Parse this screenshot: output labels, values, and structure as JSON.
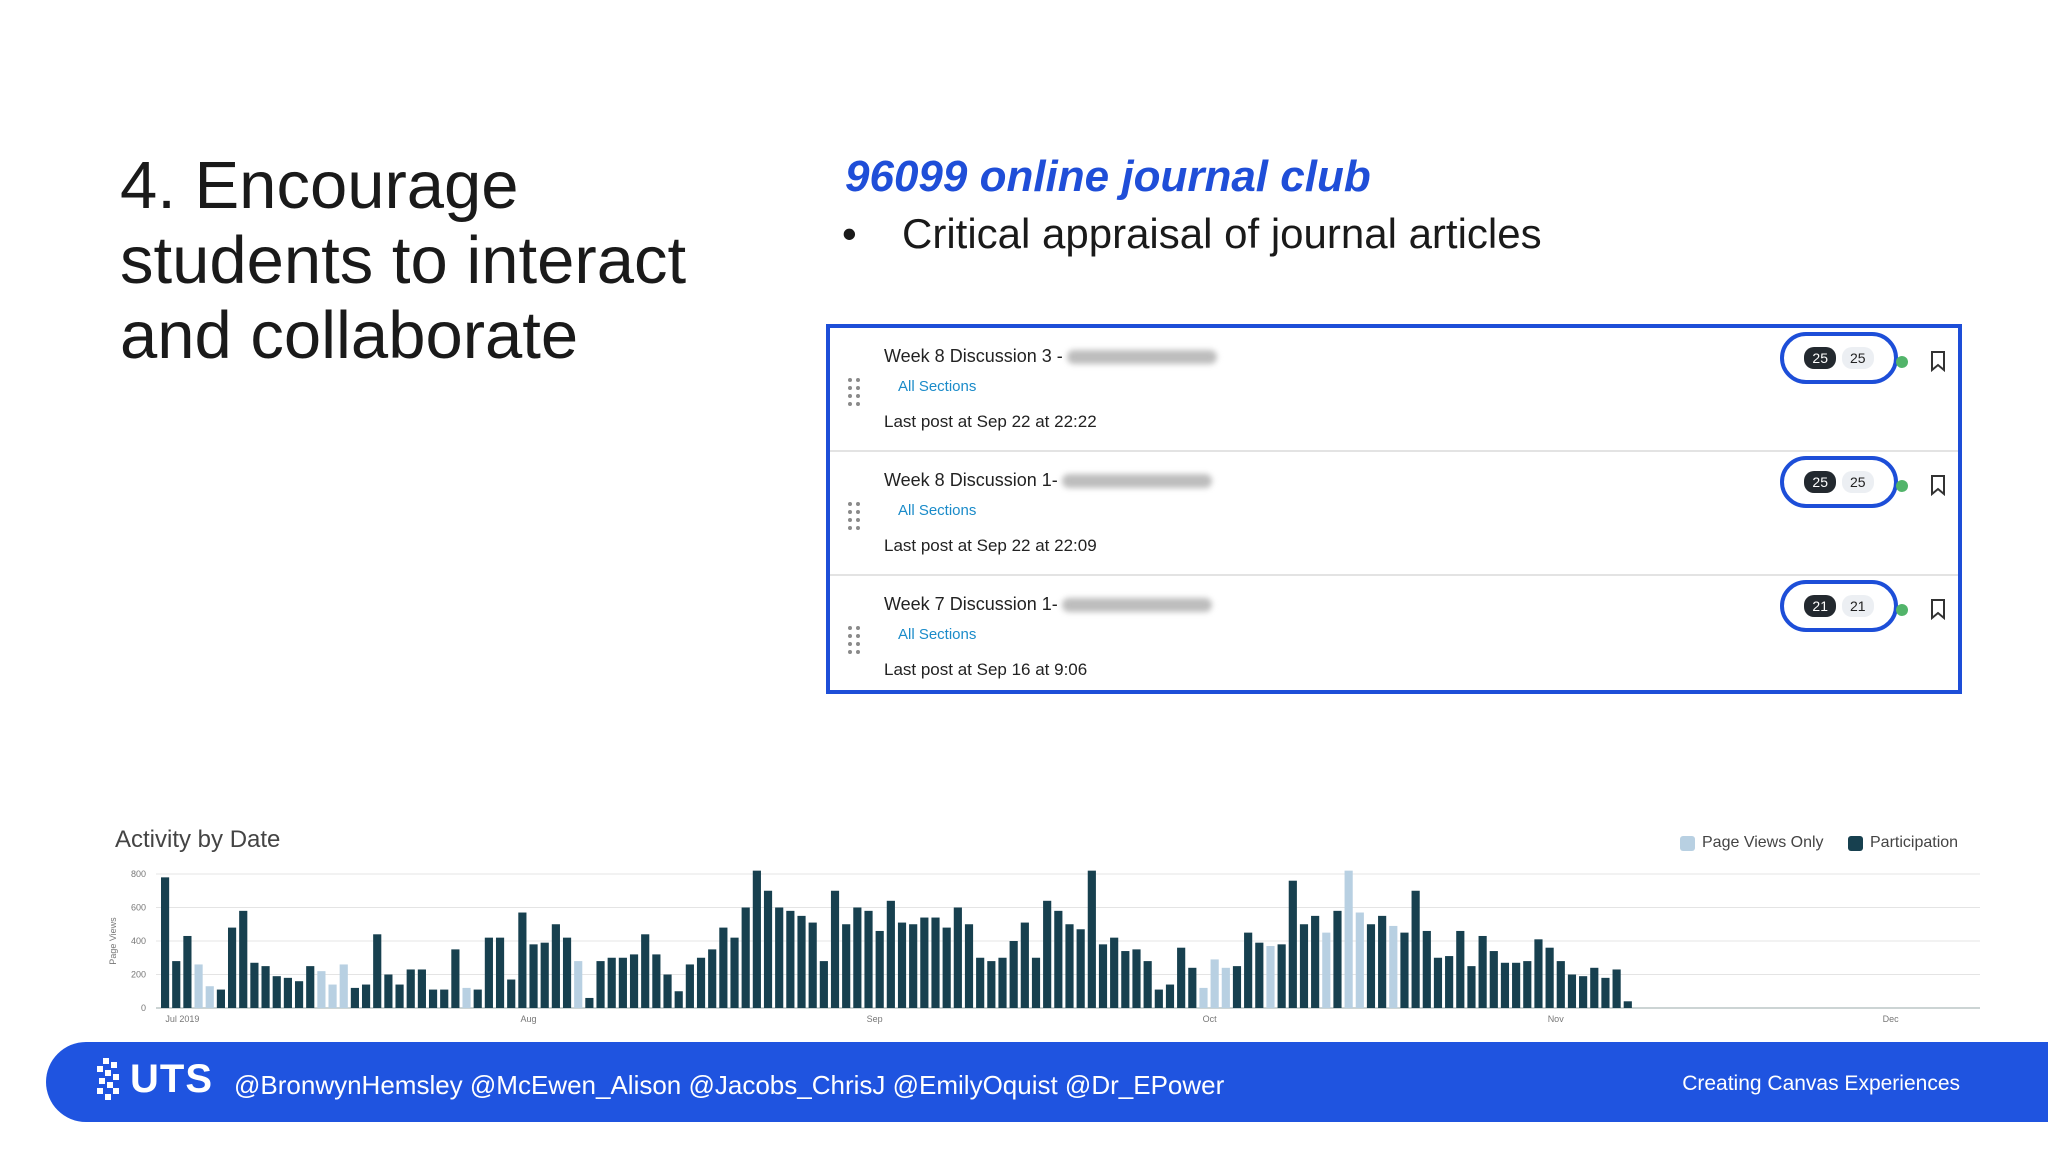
{
  "slide": {
    "title": "4. Encourage students to interact and collaborate",
    "subtitle": "96099 online journal club",
    "bullet": "Critical appraisal of journal articles",
    "bullet_marker": "•"
  },
  "discussions": [
    {
      "title": "Week 8 Discussion 3 -",
      "sections": "All Sections",
      "last_post": "Last post at Sep 22 at 22:22",
      "unread": "25",
      "total": "25"
    },
    {
      "title": "Week 8 Discussion 1-",
      "sections": "All Sections",
      "last_post": "Last post at Sep 22 at 22:09",
      "unread": "25",
      "total": "25"
    },
    {
      "title": "Week 7 Discussion 1-",
      "sections": "All Sections",
      "last_post": "Last post at Sep 16 at 9:06",
      "unread": "21",
      "total": "21"
    }
  ],
  "chart_data": {
    "type": "bar",
    "title": "Activity by Date",
    "ylabel": "Page Views",
    "ylim": [
      0,
      800
    ],
    "yticks": [
      "0",
      "200",
      "400",
      "600",
      "800"
    ],
    "xtick_labels": [
      "Jul 2019",
      "Aug",
      "Sep",
      "Oct",
      "Nov",
      "Dec"
    ],
    "xtick_days": [
      3,
      34,
      65,
      95,
      126,
      156
    ],
    "days_total": 163,
    "legend": [
      {
        "name": "Page Views Only",
        "color": "#b8d0e2"
      },
      {
        "name": "Participation",
        "color": "#17404f"
      }
    ],
    "values": [
      780,
      280,
      430,
      260,
      130,
      110,
      480,
      580,
      270,
      250,
      190,
      180,
      160,
      250,
      220,
      140,
      260,
      120,
      140,
      440,
      200,
      140,
      230,
      230,
      110,
      110,
      350,
      120,
      110,
      420,
      420,
      170,
      570,
      380,
      390,
      500,
      420,
      280,
      60,
      280,
      300,
      300,
      320,
      440,
      320,
      200,
      100,
      260,
      300,
      350,
      480,
      420,
      600,
      820,
      700,
      600,
      580,
      550,
      510,
      280,
      700,
      500,
      600,
      580,
      460,
      640,
      510,
      500,
      540,
      540,
      480,
      600,
      500,
      300,
      280,
      300,
      400,
      510,
      300,
      640,
      580,
      500,
      470,
      820,
      380,
      420,
      340,
      350,
      280,
      110,
      140,
      360,
      240,
      120,
      290,
      240,
      250,
      450,
      390,
      370,
      380,
      760,
      500,
      550,
      450,
      580,
      820,
      570,
      500,
      550,
      490,
      450,
      700,
      460,
      300,
      310,
      460,
      250,
      430,
      340,
      270,
      270,
      280,
      410,
      360,
      280,
      200,
      190,
      240,
      180,
      230,
      40
    ],
    "page_views_only_days": [
      4,
      5,
      15,
      16,
      17,
      28,
      38,
      94,
      95,
      96,
      100,
      105,
      107,
      108,
      111,
      155,
      156,
      163
    ]
  },
  "footer": {
    "logo_text": "UTS",
    "handles": "@BronwynHemsley @McEwen_Alison @Jacobs_ChrisJ @EmilyOquist @Dr_EPower",
    "brand": "Creating Canvas Experiences"
  },
  "colors": {
    "accent": "#1f54e0",
    "panel_border": "#1d4ed8",
    "link": "#1a8bc9"
  }
}
